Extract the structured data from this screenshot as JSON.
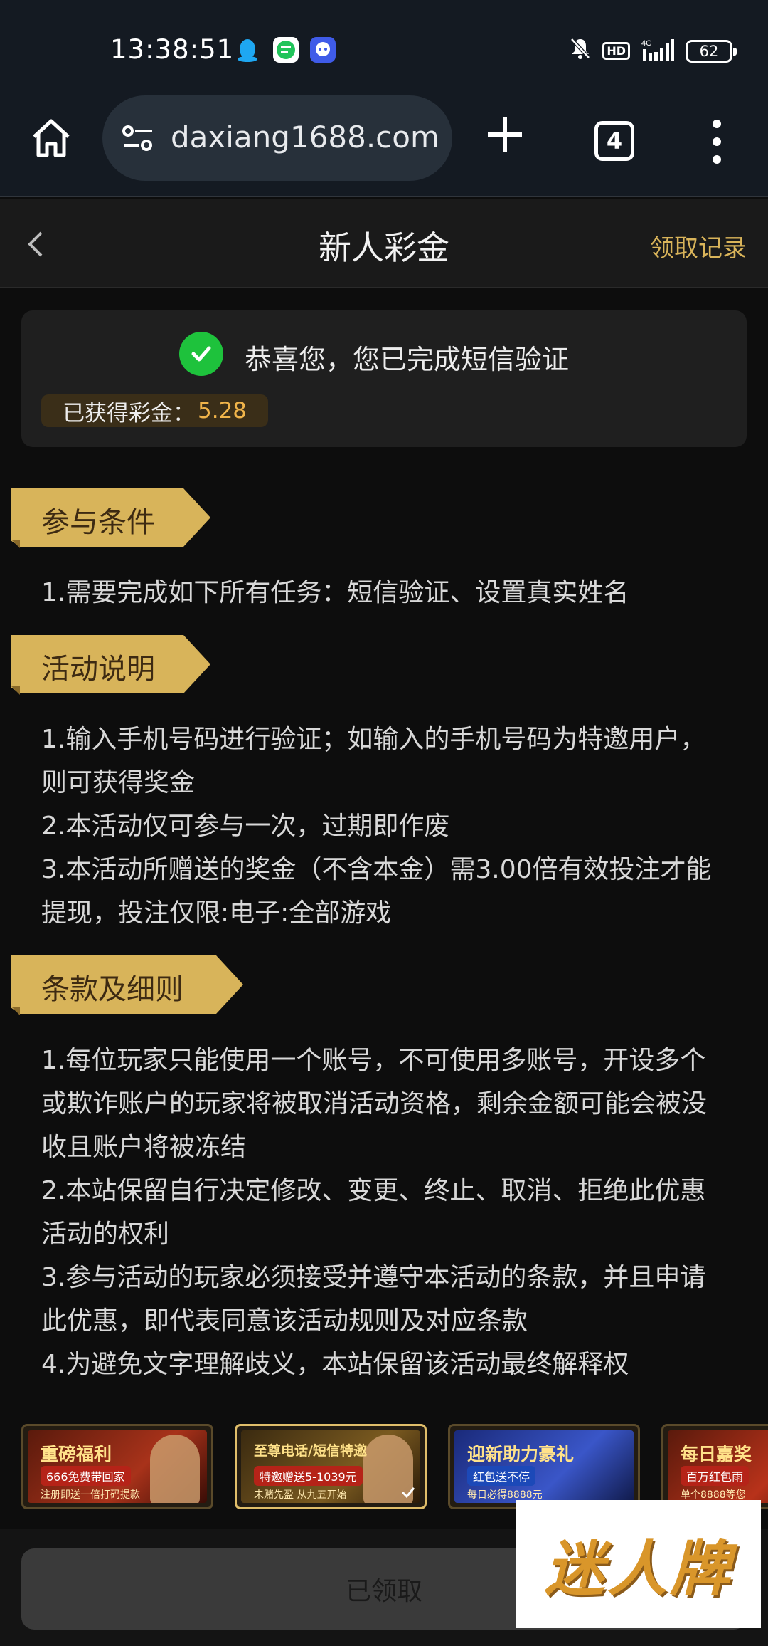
{
  "status_bar": {
    "time": "13:38:51",
    "battery": "62",
    "icons": [
      "qq-penguin-icon",
      "messages-icon",
      "bubble-chat-icon",
      "mute-bell-icon",
      "hd-icon",
      "signal-4g-icon",
      "battery-icon"
    ]
  },
  "browser": {
    "url": "daxiang1688.com",
    "tab_count": "4",
    "icons": [
      "home-icon",
      "site-settings-icon",
      "new-tab-plus-icon",
      "tabs-icon",
      "overflow-menu-icon"
    ]
  },
  "header": {
    "title": "新人彩金",
    "records_link": "领取记录"
  },
  "success_card": {
    "message": "恭喜您，您已完成短信验证",
    "bonus_label": "已获得彩金：",
    "bonus_amount": "5.28"
  },
  "sections": [
    {
      "title": "参与条件",
      "lines": [
        "1.需要完成如下所有任务：短信验证、设置真实姓名"
      ]
    },
    {
      "title": "活动说明",
      "lines": [
        "1.输入手机号码进行验证；如输入的手机号码为特邀用户，则可获得奖金",
        "2.本活动仅可参与一次，过期即作废",
        "3.本活动所赠送的奖金（不含本金）需3.00倍有效投注才能提现，投注仅限:电子:全部游戏"
      ]
    },
    {
      "title": "条款及细则",
      "lines": [
        "1.每位玩家只能使用一个账号，不可使用多账号，开设多个或欺诈账户的玩家将被取消活动资格，剩余金额可能会被没收且账户将被冻结",
        "2.本站保留自行决定修改、变更、终止、取消、拒绝此优惠活动的权利",
        "3.参与活动的玩家必须接受并遵守本活动的条款，并且申请此优惠，即代表同意该活动规则及对应条款",
        "4.为避免文字理解歧义，本站保留该活动最终解释权"
      ]
    }
  ],
  "promos": [
    {
      "title": "重磅福利",
      "sub": "666免费带回家",
      "foot": "注册即送一倍打码提款"
    },
    {
      "title": "至尊电话/短信特邀",
      "sub": "特邀赠送5-1039元",
      "foot": "未赌先盈 从九五开始"
    },
    {
      "title": "迎新助力豪礼",
      "sub": "红包送不停",
      "foot": "每日必得8888元"
    },
    {
      "title": "每日嘉奖",
      "sub": "百万红包雨",
      "foot": "单个8888等您"
    }
  ],
  "bottom": {
    "claimed_label": "已领取"
  },
  "watermark": {
    "text": "迷人牌"
  },
  "colors": {
    "gold": "#d8b45a",
    "bonus_amount": "#f0b44a",
    "check_green": "#1ec23c",
    "background": "#0d0d0d"
  }
}
